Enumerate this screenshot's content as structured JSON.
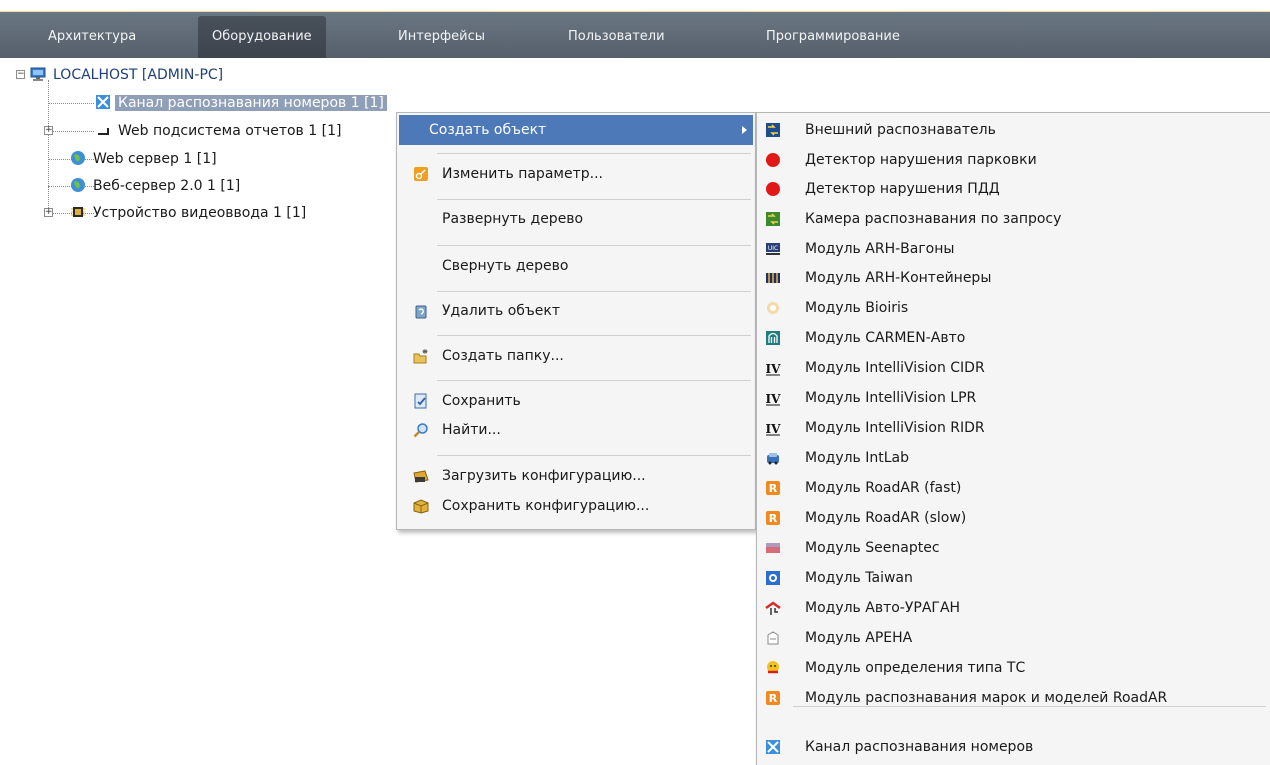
{
  "tabs": [
    {
      "label": "Архитектура"
    },
    {
      "label": "Оборудование",
      "active": true
    },
    {
      "label": "Интерфейсы"
    },
    {
      "label": "Пользователи"
    },
    {
      "label": "Программирование"
    }
  ],
  "tree": {
    "root": "LOCALHOST [ADMIN-PC]",
    "items": [
      {
        "label": "Канал распознавания номеров 1 [1]",
        "selected": true,
        "icon": "lpr-channel-icon"
      },
      {
        "label": "Web подсистема отчетов 1 [1]",
        "icon": "report-icon"
      },
      {
        "label": "Web сервер 1 [1]",
        "icon": "globe-icon"
      },
      {
        "label": "Веб-сервер 2.0 1 [1]",
        "icon": "globe-icon"
      },
      {
        "label": "Устройство видеоввода 1 [1]",
        "icon": "chip-icon"
      }
    ]
  },
  "context_menu": {
    "items": [
      {
        "label": "Создать объект",
        "icon": "",
        "has_submenu": true,
        "highlighted": true
      },
      {
        "label": "Изменить параметр...",
        "icon": "key-icon"
      },
      {
        "label": "Развернуть дерево",
        "icon": ""
      },
      {
        "label": "Свернуть дерево",
        "icon": ""
      },
      {
        "label": "Удалить объект",
        "icon": "recycle-bin-icon"
      },
      {
        "label": "Создать папку...",
        "icon": "new-folder-icon"
      },
      {
        "label": "Сохранить",
        "icon": "save-icon"
      },
      {
        "label": "Найти...",
        "icon": "magnifier-icon"
      },
      {
        "label": "Загрузить конфигурацию...",
        "icon": "load-config-icon"
      },
      {
        "label": "Сохранить конфигурацию...",
        "icon": "save-config-icon"
      }
    ]
  },
  "submenu": {
    "items": [
      {
        "label": "Внешний распознаватель",
        "icon": "external-recognizer-icon"
      },
      {
        "label": "Детектор нарушения парковки",
        "icon": "red-dot-icon"
      },
      {
        "label": "Детектор нарушения ПДД",
        "icon": "red-dot-icon"
      },
      {
        "label": "Камера распознавания по запросу",
        "icon": "request-camera-icon"
      },
      {
        "label": "Модуль ARH-Вагоны",
        "icon": "wagon-icon"
      },
      {
        "label": "Модуль ARH-Контейнеры",
        "icon": "container-icon"
      },
      {
        "label": "Модуль Bioiris",
        "icon": "bioiris-icon"
      },
      {
        "label": "Модуль CARMEN-Авто",
        "icon": "carmen-icon"
      },
      {
        "label": "Модуль IntelliVision CIDR",
        "icon": "intellivision-icon"
      },
      {
        "label": "Модуль IntelliVision LPR",
        "icon": "intellivision-icon"
      },
      {
        "label": "Модуль IntelliVision RIDR",
        "icon": "intellivision-icon"
      },
      {
        "label": "Модуль IntLab",
        "icon": "car-icon"
      },
      {
        "label": "Модуль RoadAR (fast)",
        "icon": "roadar-icon"
      },
      {
        "label": "Модуль RoadAR (slow)",
        "icon": "roadar-icon"
      },
      {
        "label": "Модуль Seenaptec",
        "icon": "seenaptec-icon"
      },
      {
        "label": "Модуль Taiwan",
        "icon": "taiwan-icon"
      },
      {
        "label": "Модуль Авто-УРАГАН",
        "icon": "uragan-icon"
      },
      {
        "label": "Модуль АРЕНА",
        "icon": "arena-icon"
      },
      {
        "label": "Модуль определения типа ТС",
        "icon": "vehicle-type-icon"
      },
      {
        "label": "Модуль распознавания марок и моделей RoadAR",
        "icon": "roadar-icon"
      },
      {
        "label": "Канал распознавания номеров",
        "icon": "lpr-channel-icon"
      }
    ]
  },
  "colors": {
    "tabbar": "#5f6a75",
    "selection": "#8f9fb8",
    "menu_highlight": "#4d79b8"
  }
}
